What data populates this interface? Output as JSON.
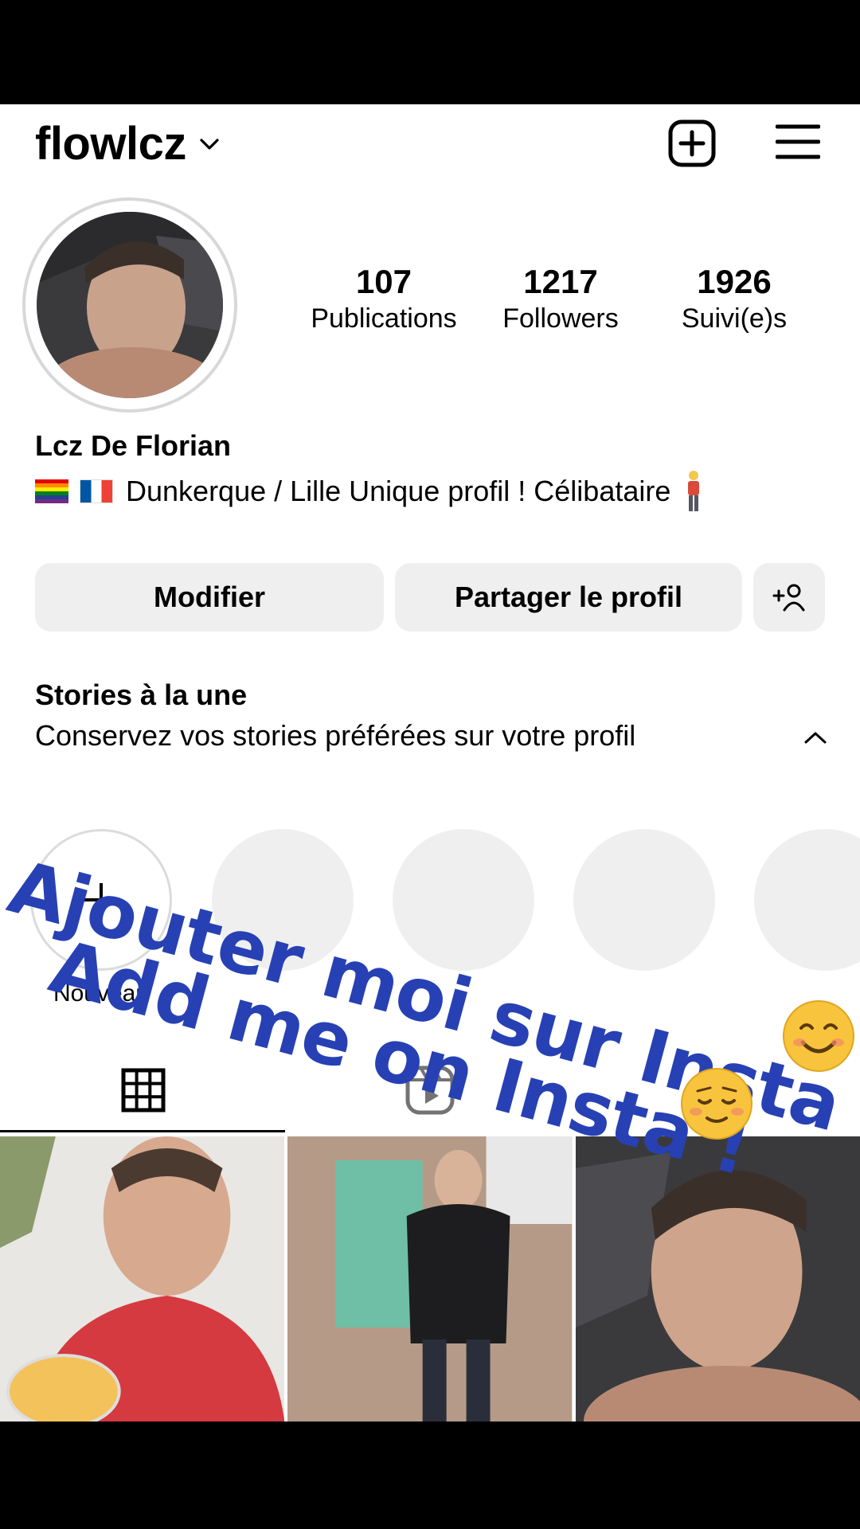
{
  "header": {
    "username": "flowlcz",
    "icons": {
      "dropdown": "chevron-down-icon",
      "add_post": "plus-square-icon",
      "menu": "hamburger-menu-icon"
    }
  },
  "profile": {
    "stats": [
      {
        "value": "107",
        "label": "Publications"
      },
      {
        "value": "1217",
        "label": "Followers"
      },
      {
        "value": "1926",
        "label": "Suivi(e)s"
      }
    ],
    "full_name": "Lcz De Florian",
    "bio": "Dunkerque / Lille Unique profil ! Célibataire",
    "bio_icons": [
      "rainbow-flag-icon",
      "france-flag-icon",
      "person-standing-icon"
    ]
  },
  "buttons": {
    "edit": "Modifier",
    "share": "Partager le profil",
    "add_user_icon": "add-person-icon"
  },
  "highlights": {
    "title": "Stories à la une",
    "subtitle": "Conservez vos stories préférées sur votre profil",
    "new_label": "Nouveau"
  },
  "tabs": [
    "grid-icon",
    "reels-icon"
  ],
  "overlay": {
    "line1": "Ajouter moi sur Insta !",
    "line2": "Add me on Insta !",
    "color": "#2741b4"
  },
  "colors": {
    "button_bg": "#efefef",
    "placeholder": "#efefef",
    "text": "#000000"
  }
}
